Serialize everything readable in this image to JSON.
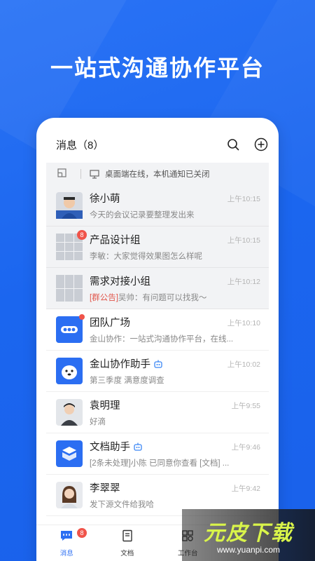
{
  "headline": "一站式沟通协作平台",
  "header": {
    "title": "消息（8）",
    "search_icon": "search-icon",
    "add_icon": "add-icon"
  },
  "notice": {
    "text": "桌面端在线，本机通知已关闭"
  },
  "messages": [
    {
      "name": "徐小萌",
      "preview": "今天的会议记录要整理发出来",
      "time": "上午10:15",
      "highlight": true
    },
    {
      "name": "产品设计组",
      "preview": "李敏：大家觉得效果图怎么样呢",
      "time": "上午10:15",
      "badge": "8",
      "highlight": true
    },
    {
      "name": "需求对接小组",
      "tag": "[群公告]",
      "preview": "吴帅：有问题可以找我～",
      "time": "上午10:12",
      "highlight": true
    },
    {
      "name": "团队广场",
      "preview": "金山协作：一站式沟通协作平台，在线...",
      "time": "上午10:10",
      "dot": true
    },
    {
      "name": "金山协作助手",
      "preview": "第三季度 满意度调查",
      "time": "上午10:02",
      "bot": true
    },
    {
      "name": "袁明理",
      "preview": "好滴",
      "time": "上午9:55"
    },
    {
      "name": "文档助手",
      "preview": "[2条未处理]小陈 已同意你查看 [文档] ...",
      "time": "上午9:46",
      "bot": true
    },
    {
      "name": "李翠翠",
      "preview": "发下源文件给我哈",
      "time": "上午9:42"
    }
  ],
  "tabs": [
    {
      "label": "消息",
      "badge": "8",
      "active": true
    },
    {
      "label": "文档"
    },
    {
      "label": "工作台"
    }
  ],
  "watermark": {
    "title": "元皮下载",
    "url": "www.yuanpi.com"
  },
  "colors": {
    "brand": "#1b66ef",
    "badge": "#f0544a",
    "tag": "#e0554a"
  }
}
